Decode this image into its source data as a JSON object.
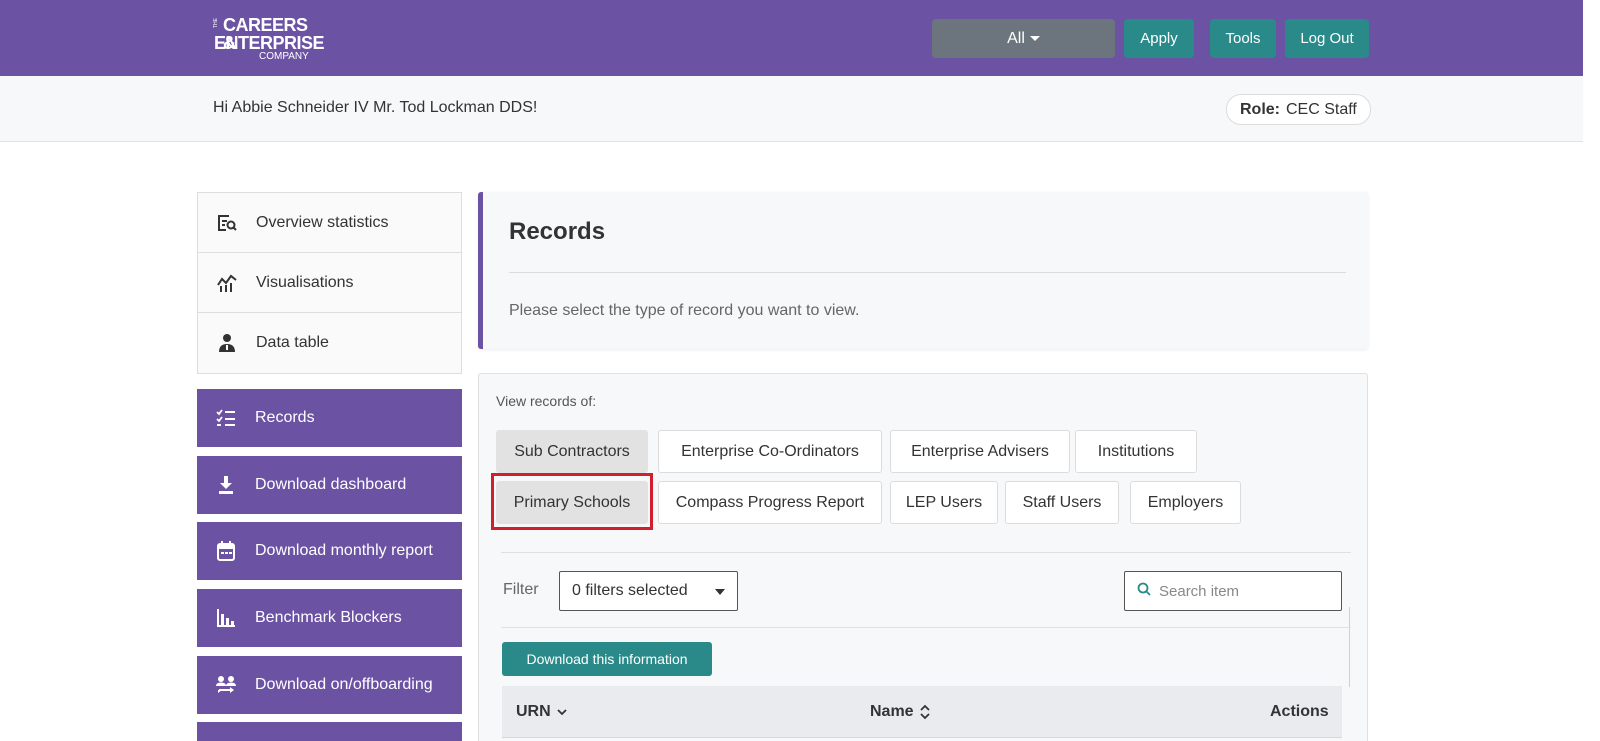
{
  "header": {
    "logo": {
      "small": "THE",
      "line1": "CAREERS &",
      "line2": "ENTERPRISE",
      "line3": "COMPANY"
    },
    "all_label": "All",
    "apply_label": "Apply",
    "tools_label": "Tools",
    "logout_label": "Log Out"
  },
  "greeting": {
    "text": "Hi Abbie Schneider IV Mr. Tod Lockman DDS!",
    "role_label": "Role:",
    "role_value": "CEC Staff"
  },
  "sidebar": {
    "white_items": [
      {
        "label": "Overview statistics",
        "icon": "overview-stats-icon"
      },
      {
        "label": "Visualisations",
        "icon": "chart-icon"
      },
      {
        "label": "Data table",
        "icon": "person-icon"
      }
    ],
    "purple_items": [
      {
        "label": "Records",
        "icon": "checklist-icon"
      },
      {
        "label": "Download dashboard",
        "icon": "download-icon"
      },
      {
        "label": "Download monthly report",
        "icon": "calendar-icon"
      },
      {
        "label": "Benchmark Blockers",
        "icon": "bar-chart-icon"
      },
      {
        "label": "Download on/offboarding",
        "icon": "people-transfer-icon"
      }
    ]
  },
  "records": {
    "title": "Records",
    "description": "Please select the type of record you want to view."
  },
  "panel": {
    "view_label": "View records of:",
    "chips_row1": [
      "Sub Contractors",
      "Enterprise Co-Ordinators",
      "Enterprise Advisers",
      "Institutions"
    ],
    "chips_row2": [
      "Primary Schools",
      "Compass Progress Report",
      "LEP Users",
      "Staff Users",
      "Employers"
    ],
    "filter_label": "Filter",
    "filter_value": "0 filters selected",
    "search_placeholder": "Search item",
    "download_label": "Download this information",
    "table_headers": {
      "urn": "URN",
      "name": "Name",
      "actions": "Actions"
    }
  },
  "colors": {
    "brand_purple": "#6b52a3",
    "teal": "#2a8a8a",
    "highlight_red": "#d0202e",
    "grey_button": "#6c757d"
  }
}
